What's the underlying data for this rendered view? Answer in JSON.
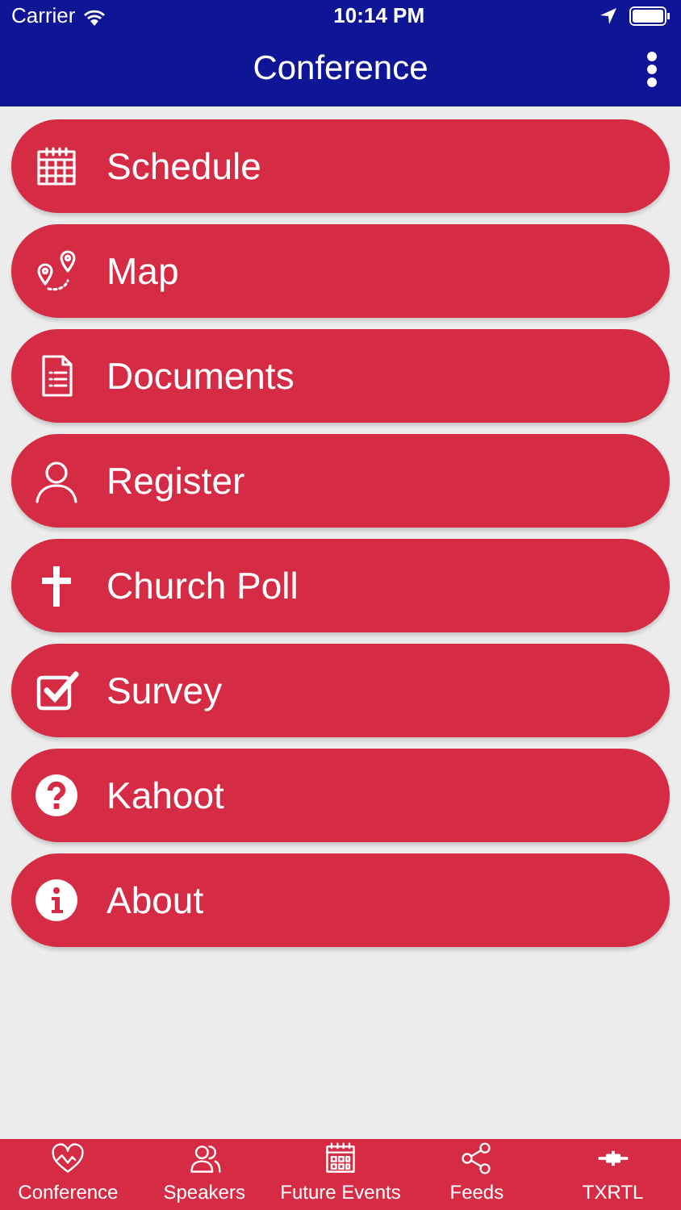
{
  "status_bar": {
    "carrier": "Carrier",
    "time": "10:14 PM"
  },
  "nav_bar": {
    "title": "Conference"
  },
  "menu": [
    {
      "label": "Schedule"
    },
    {
      "label": "Map"
    },
    {
      "label": "Documents"
    },
    {
      "label": "Register"
    },
    {
      "label": "Church Poll"
    },
    {
      "label": "Survey"
    },
    {
      "label": "Kahoot"
    },
    {
      "label": "About"
    }
  ],
  "tab_bar": [
    {
      "label": "Conference"
    },
    {
      "label": "Speakers"
    },
    {
      "label": "Future Events"
    },
    {
      "label": "Feeds"
    },
    {
      "label": "TXRTL"
    }
  ]
}
